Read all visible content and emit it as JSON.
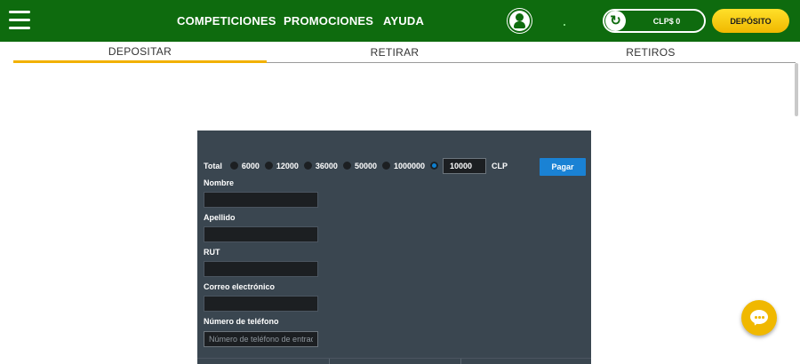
{
  "header": {
    "nav": [
      "COMPETICIONES",
      "PROMOCIONES",
      "AYUDA"
    ],
    "balance": "CLP$ 0",
    "deposit_button": "DEPÓSITO"
  },
  "tabs": [
    "DEPOSITAR",
    "RETIRAR",
    "RETIROS"
  ],
  "form": {
    "total_label": "Total",
    "amounts": [
      "6000",
      "12000",
      "36000",
      "50000",
      "1000000"
    ],
    "custom_amount": "10000",
    "currency": "CLP",
    "pay_button": "Pagar",
    "fields": {
      "name": "Nombre",
      "surname": "Apellido",
      "rut": "RUT",
      "email": "Correo electrónico",
      "phone": "Número de teléfono",
      "phone_placeholder": "Número de teléfono de entrada"
    }
  },
  "colors": {
    "header_green": "#0e6b0e",
    "deposit_yellow": "#f0b800",
    "panel_bg": "#3a4650",
    "pay_blue": "#1a82d4"
  }
}
